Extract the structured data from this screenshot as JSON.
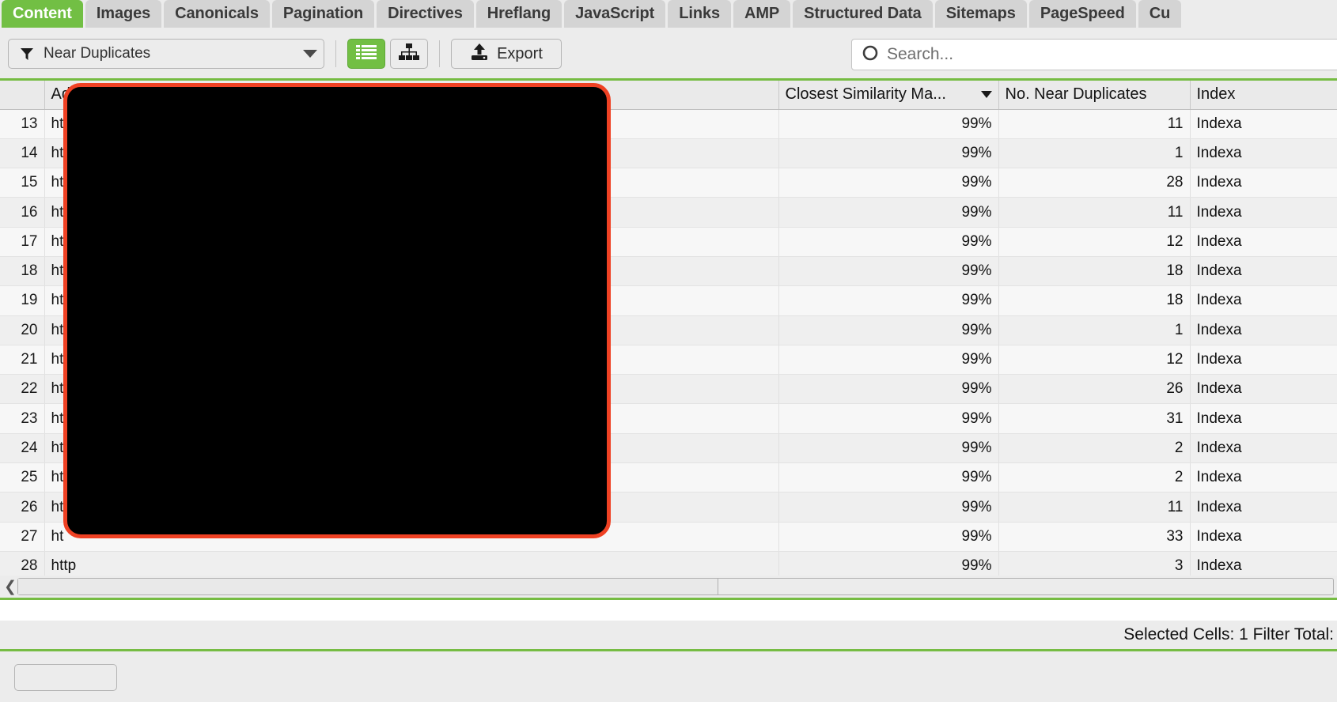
{
  "tabs": [
    {
      "label": "Content",
      "active": true
    },
    {
      "label": "Images",
      "active": false
    },
    {
      "label": "Canonicals",
      "active": false
    },
    {
      "label": "Pagination",
      "active": false
    },
    {
      "label": "Directives",
      "active": false
    },
    {
      "label": "Hreflang",
      "active": false
    },
    {
      "label": "JavaScript",
      "active": false
    },
    {
      "label": "Links",
      "active": false
    },
    {
      "label": "AMP",
      "active": false
    },
    {
      "label": "Structured Data",
      "active": false
    },
    {
      "label": "Sitemaps",
      "active": false
    },
    {
      "label": "PageSpeed",
      "active": false
    },
    {
      "label": "Cu",
      "active": false
    }
  ],
  "toolbar": {
    "filter_value": "Near Duplicates",
    "filter_icon": "funnel-icon",
    "dropdown_icon": "chevron-down-icon",
    "list_view_icon": "list-view-icon",
    "tree_view_icon": "tree-view-icon",
    "export_label": "Export",
    "export_icon": "upload-icon",
    "search_placeholder": "Search...",
    "search_value": "",
    "search_icon": "circle-search-icon"
  },
  "colors": {
    "accent_green": "#72bf44",
    "rule_green": "#76bc43",
    "redaction_border": "#ef4123",
    "redaction_fill": "#000000"
  },
  "table": {
    "columns": [
      {
        "key": "num",
        "label": ""
      },
      {
        "key": "addr",
        "label": "Address"
      },
      {
        "key": "sim",
        "label": "Closest Similarity Ma...",
        "sorted": true,
        "sort_dir": "desc"
      },
      {
        "key": "dup",
        "label": "No. Near Duplicates"
      },
      {
        "key": "idx",
        "label": "Index"
      }
    ],
    "rows": [
      {
        "num": "13",
        "addr": "ht",
        "sim": "99%",
        "dup": "11",
        "idx": "Indexa"
      },
      {
        "num": "14",
        "addr": "ht",
        "sim": "99%",
        "dup": "1",
        "idx": "Indexa"
      },
      {
        "num": "15",
        "addr": "ht",
        "sim": "99%",
        "dup": "28",
        "idx": "Indexa"
      },
      {
        "num": "16",
        "addr": "ht",
        "sim": "99%",
        "dup": "11",
        "idx": "Indexa"
      },
      {
        "num": "17",
        "addr": "ht",
        "sim": "99%",
        "dup": "12",
        "idx": "Indexa"
      },
      {
        "num": "18",
        "addr": "ht",
        "sim": "99%",
        "dup": "18",
        "idx": "Indexa"
      },
      {
        "num": "19",
        "addr": "ht",
        "sim": "99%",
        "dup": "18",
        "idx": "Indexa"
      },
      {
        "num": "20",
        "addr": "ht",
        "sim": "99%",
        "dup": "1",
        "idx": "Indexa"
      },
      {
        "num": "21",
        "addr": "ht",
        "sim": "99%",
        "dup": "12",
        "idx": "Indexa"
      },
      {
        "num": "22",
        "addr": "ht",
        "sim": "99%",
        "dup": "26",
        "idx": "Indexa"
      },
      {
        "num": "23",
        "addr": "ht",
        "sim": "99%",
        "dup": "31",
        "idx": "Indexa"
      },
      {
        "num": "24",
        "addr": "ht",
        "sim": "99%",
        "dup": "2",
        "idx": "Indexa"
      },
      {
        "num": "25",
        "addr": "ht",
        "sim": "99%",
        "dup": "2",
        "idx": "Indexa"
      },
      {
        "num": "26",
        "addr": "ht",
        "sim": "99%",
        "dup": "11",
        "idx": "Indexa"
      },
      {
        "num": "27",
        "addr": "ht",
        "sim": "99%",
        "dup": "33",
        "idx": "Indexa"
      },
      {
        "num": "28",
        "addr": "http",
        "sim": "99%",
        "dup": "3",
        "idx": "Indexa"
      }
    ]
  },
  "scrollbar": {
    "left_arrow_icon": "chevron-left-icon"
  },
  "status": {
    "text": "Selected Cells:  1  Filter Total:"
  }
}
